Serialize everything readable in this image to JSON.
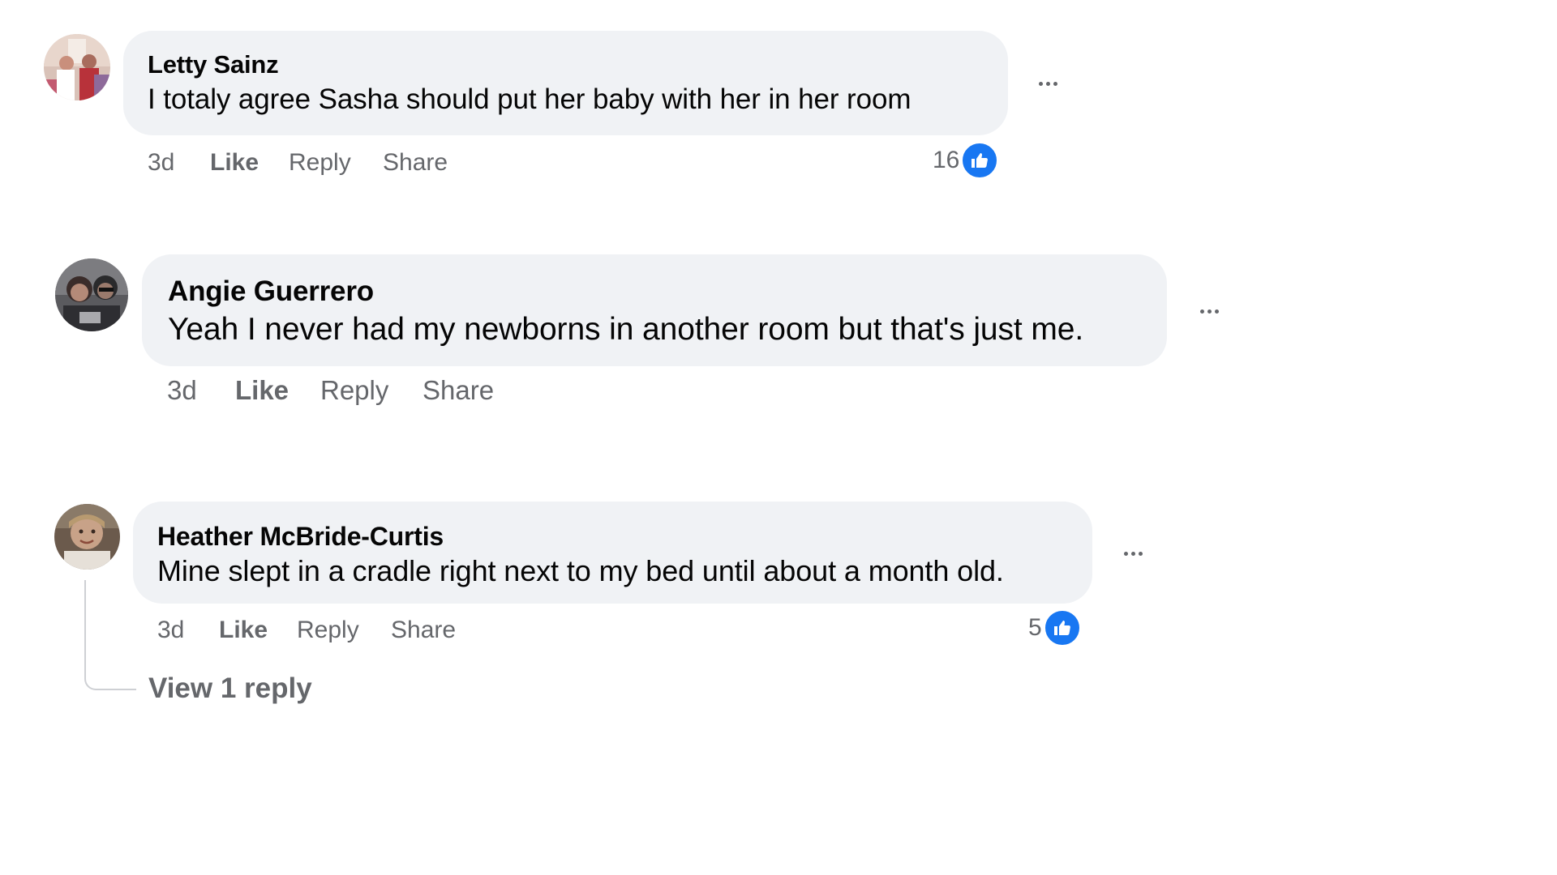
{
  "comments": [
    {
      "author": "Letty Sainz",
      "text": "I totaly agree Sasha should put her baby with her in her room",
      "time": "3d",
      "like_label": "Like",
      "reply_label": "Reply",
      "share_label": "Share",
      "reaction_count": "16",
      "avatar_icon": "avatar-photo",
      "more_icon": "more-options-icon"
    },
    {
      "author": "Angie Guerrero",
      "text": "Yeah I never had my newborns in another room but that's just me.",
      "time": "3d",
      "like_label": "Like",
      "reply_label": "Reply",
      "share_label": "Share",
      "avatar_icon": "avatar-photo",
      "more_icon": "more-options-icon"
    },
    {
      "author": "Heather McBride-Curtis",
      "text": "Mine slept in a cradle right next to my bed until about a month old.",
      "time": "3d",
      "like_label": "Like",
      "reply_label": "Reply",
      "share_label": "Share",
      "reaction_count": "5",
      "view_replies": "View 1 reply",
      "avatar_icon": "avatar-photo",
      "more_icon": "more-options-icon"
    }
  ],
  "colors": {
    "bubble": "#f0f2f5",
    "secondary_text": "#65676b",
    "like_blue": "#1877f2",
    "thread_line": "#ced0d4"
  }
}
